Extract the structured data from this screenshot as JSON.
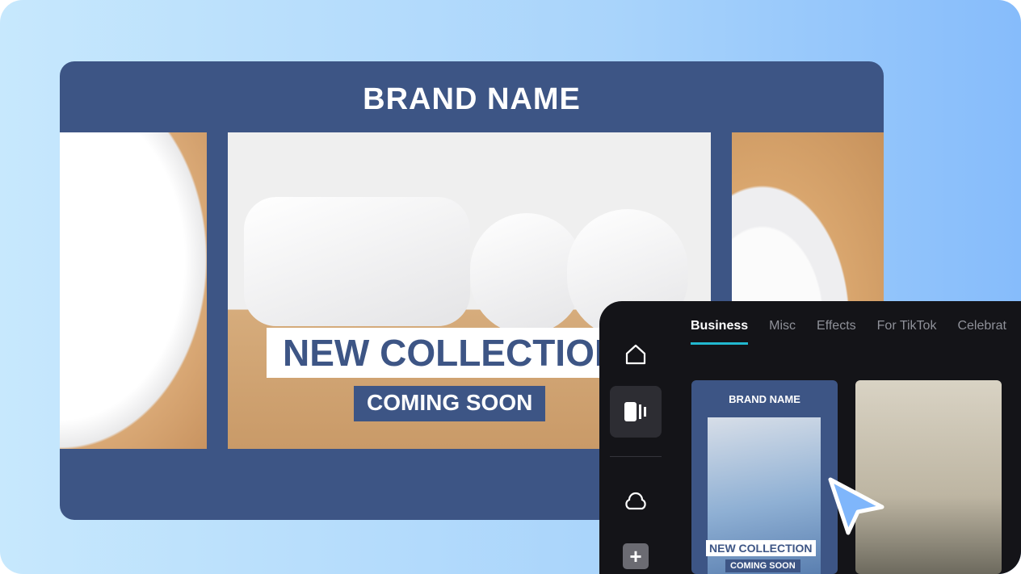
{
  "banner": {
    "brand": "BRAND NAME",
    "headline": "NEW COLLECTION",
    "subline": "COMING SOON"
  },
  "app": {
    "tabs": [
      {
        "label": "Business",
        "active": true
      },
      {
        "label": "Misc"
      },
      {
        "label": "Effects"
      },
      {
        "label": "For TikTok"
      },
      {
        "label": "Celebrat"
      }
    ],
    "sidebar": [
      "home-icon",
      "templates-icon",
      "cloud-icon",
      "plus-icon"
    ],
    "template1": {
      "brand": "BRAND NAME",
      "headline": "NEW COLLECTION",
      "subline": "COMING SOON"
    }
  },
  "colors": {
    "brand_blue": "#3d5585",
    "accent": "#22b8cf",
    "cursor": "#7fb6fb"
  }
}
